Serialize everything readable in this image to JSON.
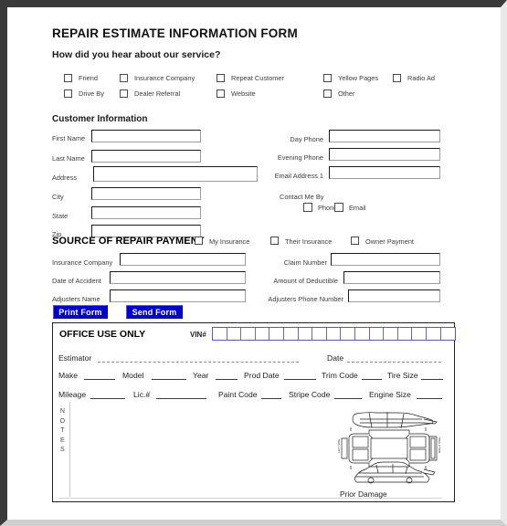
{
  "form": {
    "title": "REPAIR ESTIMATE INFORMATION FORM",
    "referral_question": "How did you hear about our service?",
    "referral_options_row1": [
      "Friend",
      "Insurance Company",
      "Repeat Customer",
      "Yellow Pages",
      "Radio Ad"
    ],
    "referral_options_row2": [
      "Drive By",
      "Dealer Referral",
      "Website",
      "Other"
    ],
    "customer_section_title": "Customer Information",
    "customer_fields_left": [
      {
        "label": "First Name",
        "value": ""
      },
      {
        "label": "Last Name",
        "value": ""
      },
      {
        "label": "Address",
        "value": ""
      },
      {
        "label": "City",
        "value": ""
      },
      {
        "label": "State",
        "value": ""
      },
      {
        "label": "Zip",
        "value": ""
      }
    ],
    "customer_fields_right": [
      {
        "label": "Day Phone",
        "value": ""
      },
      {
        "label": "Evening Phone",
        "value": ""
      },
      {
        "label": "Email Address 1",
        "value": ""
      }
    ],
    "contact_me_by_label": "Contact Me By",
    "contact_me_by_options": [
      "Phone",
      "Email"
    ],
    "payment_section_title": "SOURCE OF REPAIR PAYMENT",
    "payment_options": [
      "My Insurance",
      "Their Insurance",
      "Owner Payment"
    ],
    "payment_fields_left": [
      {
        "label": "Insurance Company",
        "value": ""
      },
      {
        "label": "Date of Accident",
        "value": ""
      },
      {
        "label": "Adjusters Name",
        "value": ""
      }
    ],
    "payment_fields_right": [
      {
        "label": "Claim Number",
        "value": ""
      },
      {
        "label": "Amount of Deductible",
        "value": ""
      },
      {
        "label": "Adjusters Phone Number",
        "value": ""
      }
    ],
    "buttons": {
      "print": "Print Form",
      "send": "Send Form",
      "color": "#0000cc",
      "text_color": "#ffffff"
    }
  },
  "office_use": {
    "title": "OFFICE USE ONLY",
    "vin_label": "VIN#",
    "vin_cells": 17,
    "row_estimator": [
      {
        "label": "Estimator",
        "value": ""
      },
      {
        "label": "Date",
        "value": ""
      }
    ],
    "row_vehicle": [
      {
        "label": "Make",
        "value": ""
      },
      {
        "label": "Model",
        "value": ""
      },
      {
        "label": "Year",
        "value": ""
      },
      {
        "label": "Prod Date",
        "value": ""
      },
      {
        "label": "Trim Code",
        "value": ""
      },
      {
        "label": "Tire Size",
        "value": ""
      }
    ],
    "row_details": [
      {
        "label": "Mileage",
        "value": ""
      },
      {
        "label": "Lic.#",
        "value": ""
      },
      {
        "label": "Paint Code",
        "value": ""
      },
      {
        "label": "Stripe Code",
        "value": ""
      },
      {
        "label": "Engine Size",
        "value": ""
      }
    ],
    "notes_label": "NOTES",
    "diagram_caption": "Prior Damage",
    "diagram_side_labels": [
      "LEFT SIDE",
      "RIGHT SIDE"
    ]
  }
}
